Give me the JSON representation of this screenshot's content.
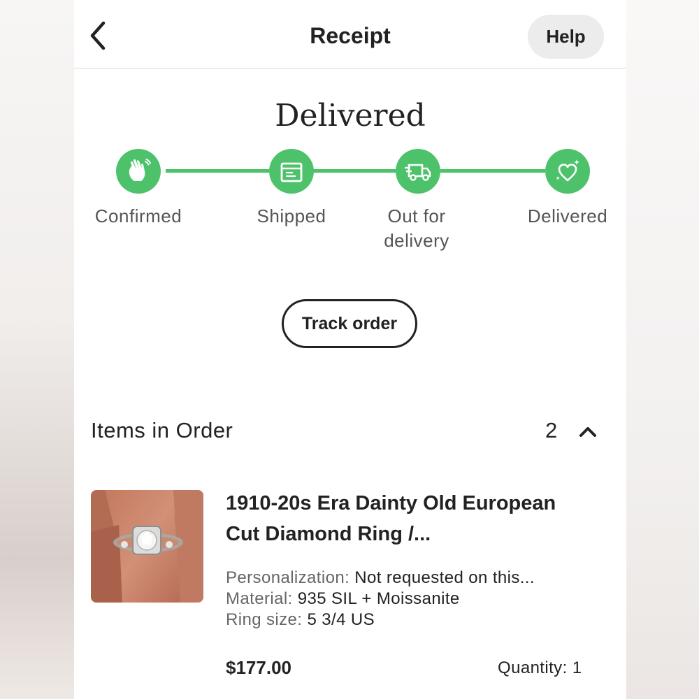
{
  "header": {
    "title": "Receipt",
    "back_icon": "chevron-left-icon",
    "help_label": "Help"
  },
  "status": {
    "title": "Delivered",
    "accent_color": "#4dc26a",
    "steps": [
      {
        "label": "Confirmed",
        "icon": "waving-hand-icon",
        "completed": true
      },
      {
        "label": "Shipped",
        "icon": "package-icon",
        "completed": true
      },
      {
        "label": "Out for delivery",
        "icon": "delivery-truck-icon",
        "completed": true
      },
      {
        "label": "Delivered",
        "icon": "sparkle-heart-icon",
        "completed": true
      }
    ]
  },
  "track_button": {
    "label": "Track order"
  },
  "items_section": {
    "title": "Items in Order",
    "count": "2",
    "toggle_icon": "chevron-up-icon"
  },
  "items": [
    {
      "title": "1910-20s Era Dainty Old European Cut Diamond Ring /...",
      "attributes": [
        {
          "key": "Personalization:",
          "value": "Not requested on this..."
        },
        {
          "key": "Material:",
          "value": "935 SIL + Moissanite"
        },
        {
          "key": "Ring size:",
          "value": "5 3/4 US"
        }
      ],
      "price": "$177.00",
      "quantity": "Quantity: 1"
    }
  ]
}
